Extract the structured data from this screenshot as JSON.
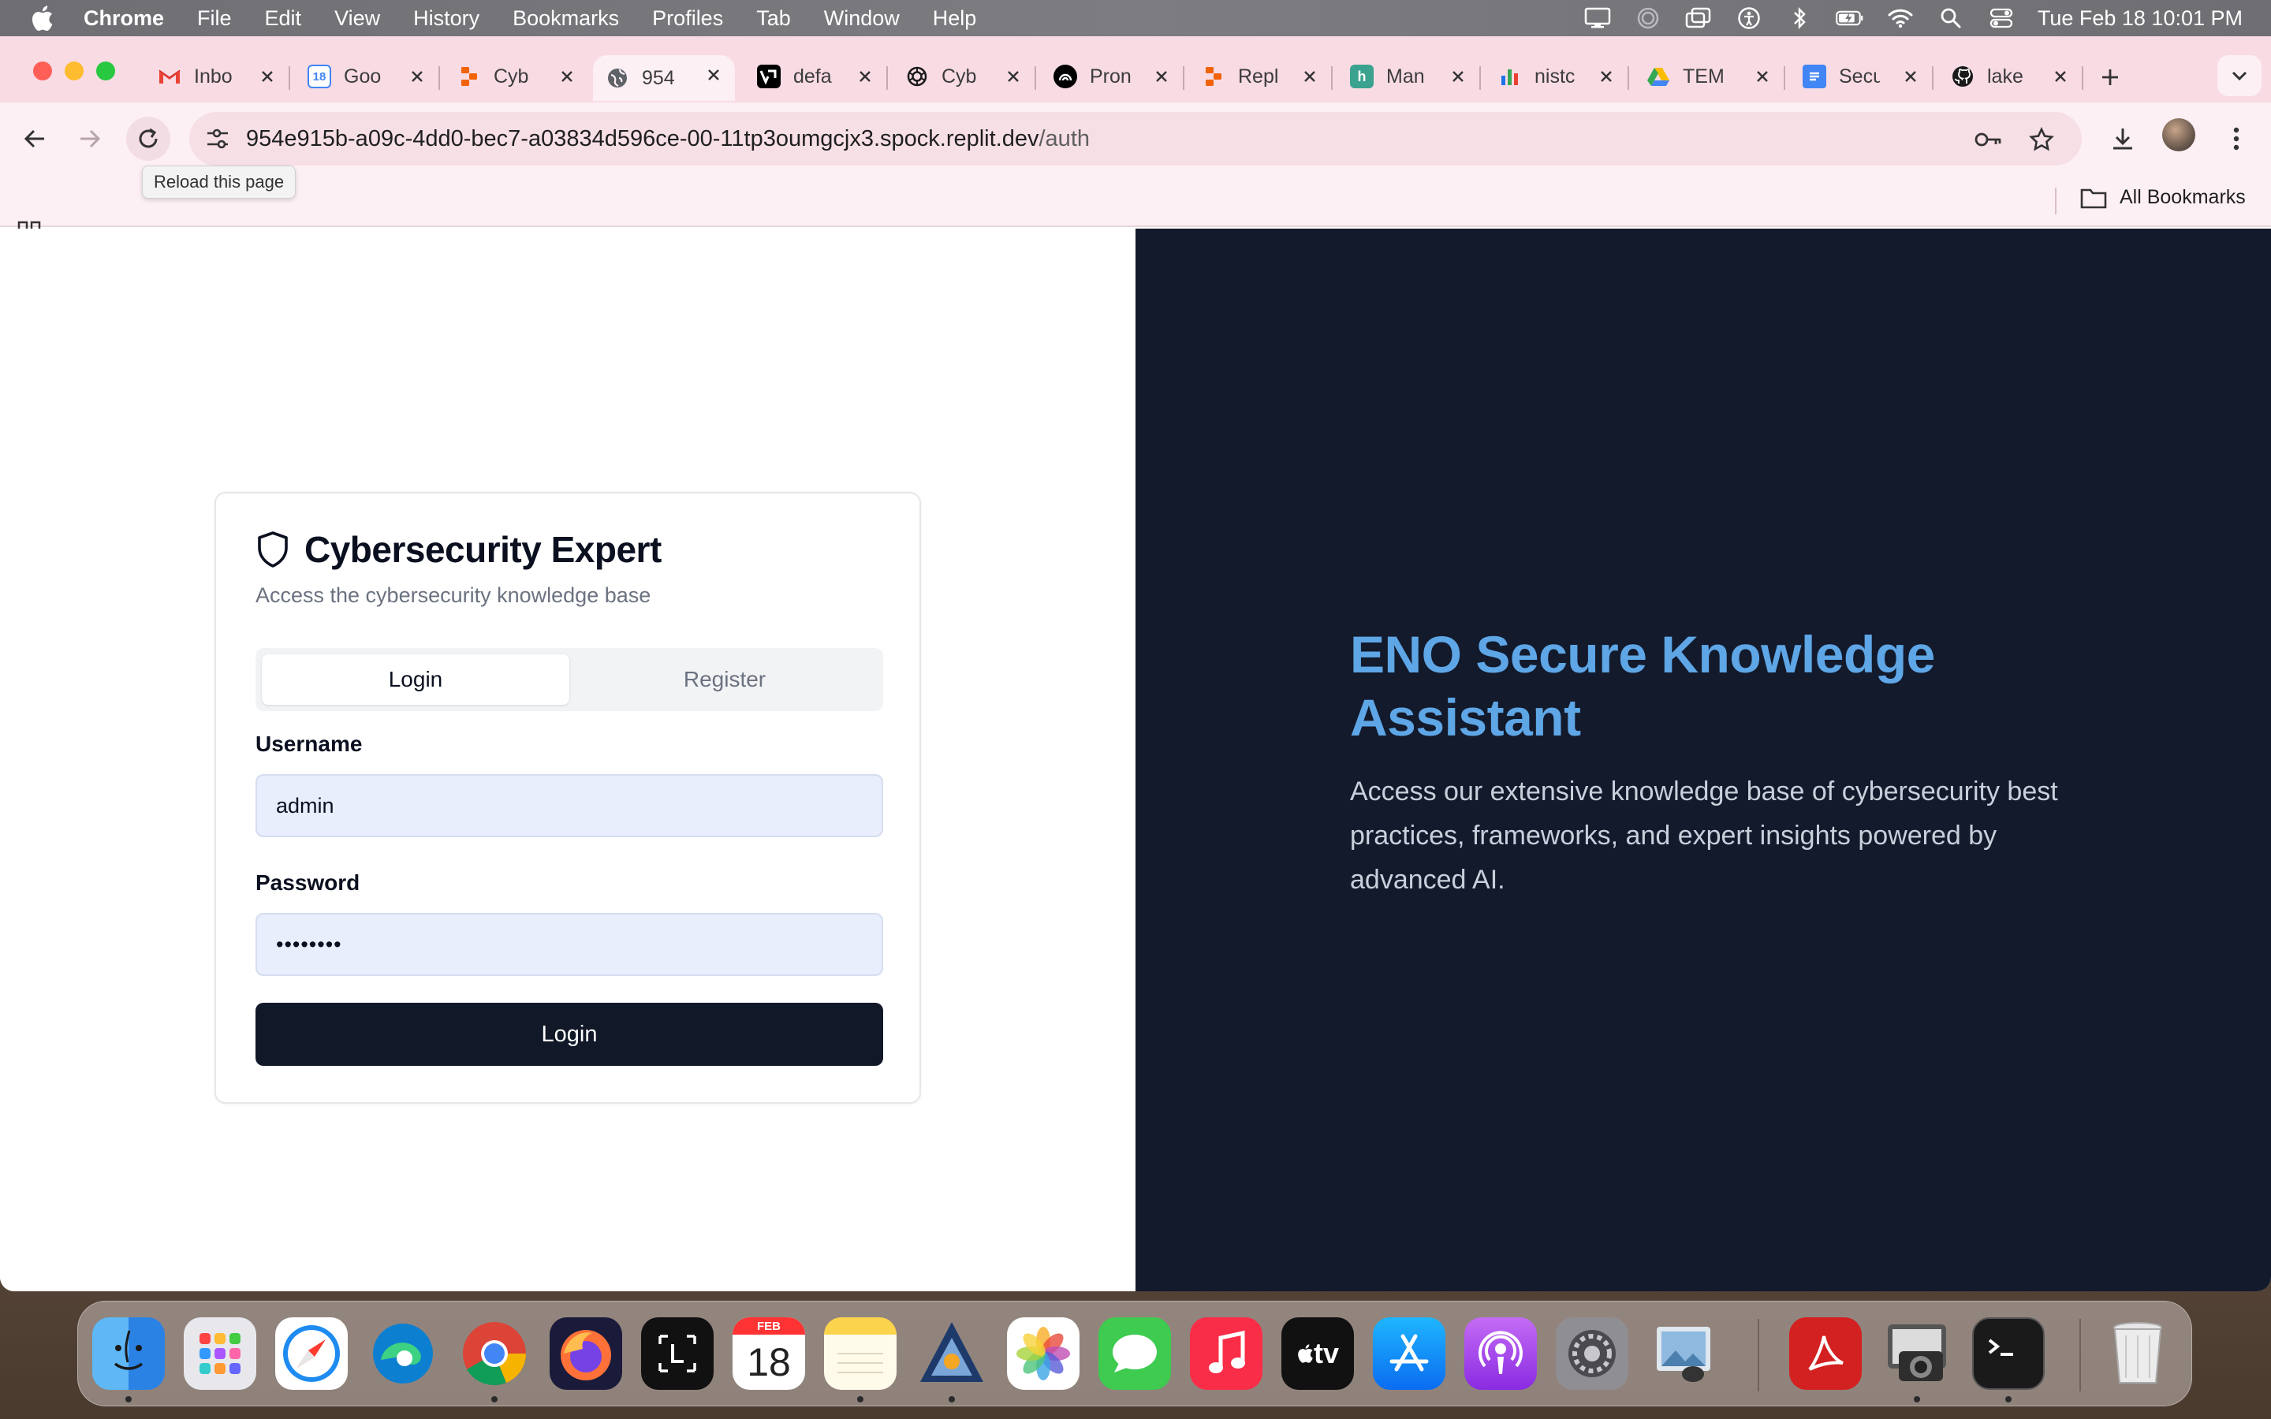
{
  "menubar": {
    "app_name": "Chrome",
    "items": [
      "File",
      "Edit",
      "View",
      "History",
      "Bookmarks",
      "Profiles",
      "Tab",
      "Window",
      "Help"
    ],
    "clock": "Tue Feb 18  10:01 PM"
  },
  "tabs": [
    {
      "title": "Inbo",
      "icon": "gmail-icon"
    },
    {
      "title": "Goo",
      "icon": "google-calendar-icon"
    },
    {
      "title": "Cyb",
      "icon": "replit-icon"
    },
    {
      "title": "954",
      "icon": "globe-icon",
      "active": true
    },
    {
      "title": "defa",
      "icon": "v0-icon"
    },
    {
      "title": "Cyb",
      "icon": "openai-icon"
    },
    {
      "title": "Pron",
      "icon": "perplexity-icon"
    },
    {
      "title": "Repl",
      "icon": "replit-icon"
    },
    {
      "title": "Man",
      "icon": "h-icon"
    },
    {
      "title": "nistc",
      "icon": "bar-chart-icon"
    },
    {
      "title": "TEM",
      "icon": "google-drive-icon"
    },
    {
      "title": "Secu",
      "icon": "google-docs-icon"
    },
    {
      "title": "lake",
      "icon": "github-icon"
    }
  ],
  "address": {
    "host": "954e915b-a09c-4dd0-bec7-a03834d596ce-00-11tp3oumgcjx3.spock.replit.dev",
    "path": "/auth"
  },
  "tooltip": "Reload this page",
  "bookmarks": {
    "all_label": "All Bookmarks"
  },
  "card": {
    "title": "Cybersecurity Expert",
    "subtitle": "Access the cybersecurity knowledge base",
    "tab_login": "Login",
    "tab_register": "Register",
    "username_label": "Username",
    "username_value": "admin",
    "password_label": "Password",
    "password_value": "••••••••",
    "submit_label": "Login"
  },
  "hero": {
    "title": "ENO Secure Knowledge Assistant",
    "body": "Access our extensive knowledge base of cybersecurity best practices, frameworks, and expert insights powered by advanced AI."
  },
  "dock": {
    "apps": [
      "finder",
      "launchpad",
      "safari",
      "edge",
      "chrome",
      "firefox",
      "lasso",
      "calendar",
      "notes",
      "altair",
      "photos",
      "messages",
      "music",
      "apple-tv",
      "app-store",
      "podcasts",
      "system-settings",
      "preview",
      "acrobat",
      "image-capture",
      "terminal",
      "trash"
    ],
    "calendar_month": "FEB",
    "calendar_day": "18",
    "appletv_label": "tv"
  },
  "colors": {
    "tab_strip": "#f9dbe4",
    "toolbar": "#fdf0f4",
    "hero_title": "#5ea6e6",
    "right_panel": "#131a2c",
    "primary_button": "#111827"
  }
}
